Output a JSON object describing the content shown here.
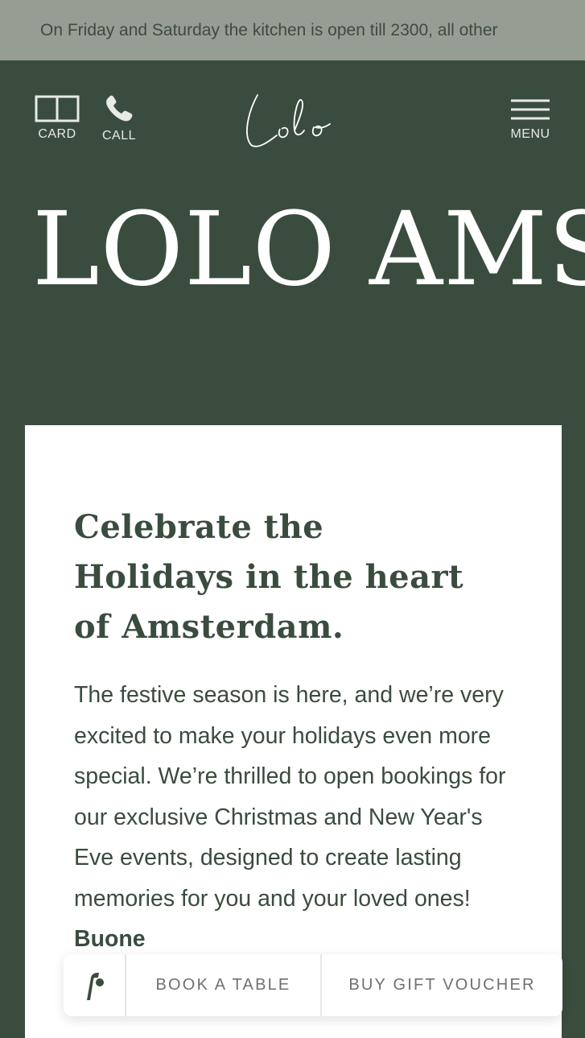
{
  "announcement": "On Friday and Saturday the kitchen is open till 2300, all other",
  "header": {
    "card_label": "CARD",
    "call_label": "CALL",
    "menu_label": "MENU",
    "logo_text": "Lolo",
    "icons": {
      "card": "book-icon",
      "call": "phone-icon",
      "menu": "hamburger-icon"
    }
  },
  "hero": {
    "title": "LOLO AMST"
  },
  "intro": {
    "heading": "Celebrate the Holidays in the heart of Amsterdam.",
    "body": "The festive season is here, and we’re very excited to make your holidays even more special. We’re thrilled to open bookings for our exclusive Christmas and New Year's Eve events, designed to create lasting memories for you and your loved ones! ",
    "body_bold": "Buone"
  },
  "actions": {
    "book_label": "BOOK A TABLE",
    "gift_label": "BUY GIFT VOUCHER",
    "booking_logo_icon": "resy-logo-icon"
  },
  "colors": {
    "background": "#3a4c3e",
    "announcement_bg": "#969e93",
    "card_bg": "#ffffff",
    "text_dark": "#3a4c3e"
  }
}
